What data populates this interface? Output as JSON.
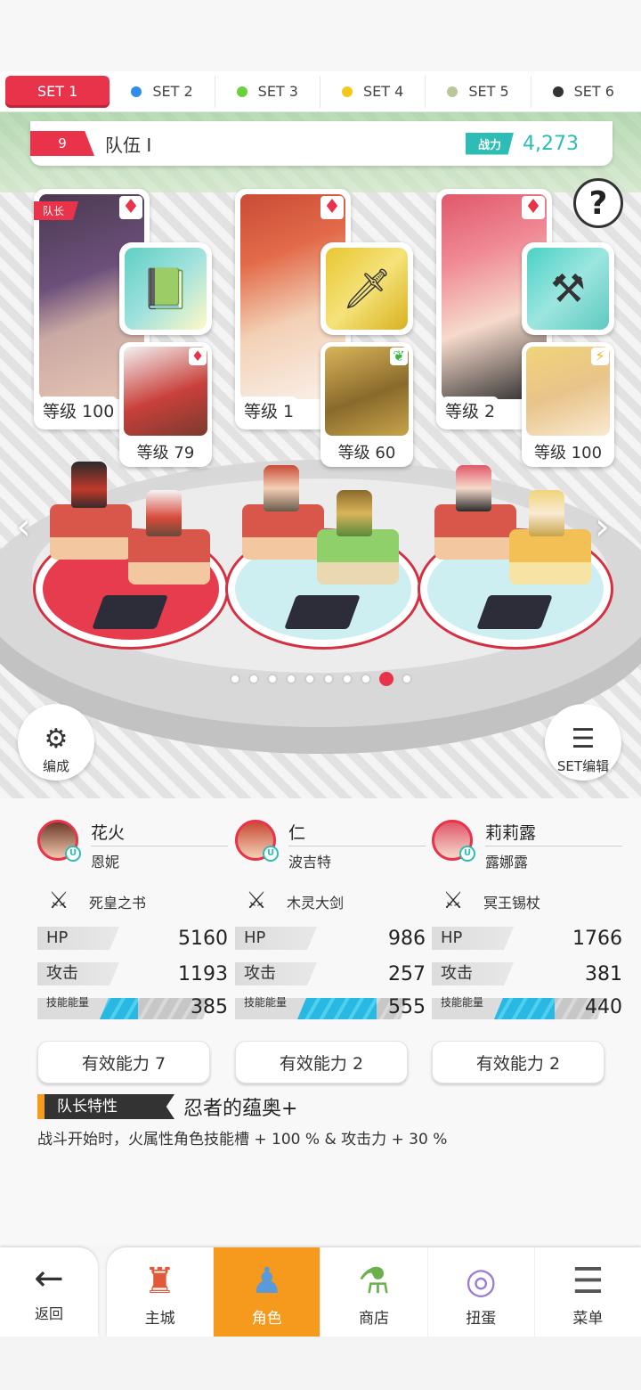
{
  "set_tabs": [
    {
      "label": "SET 1",
      "color": "",
      "active": true
    },
    {
      "label": "SET 2",
      "color": "#2e8ef0"
    },
    {
      "label": "SET 3",
      "color": "#6ad13a"
    },
    {
      "label": "SET 4",
      "color": "#f2c81c"
    },
    {
      "label": "SET 5",
      "color": "#b9c79a"
    },
    {
      "label": "SET 6",
      "color": "#333333"
    }
  ],
  "team": {
    "number": "9",
    "name": "队伍 I",
    "power_label": "战力",
    "power_value": "4,273"
  },
  "help": "?",
  "cards": [
    {
      "leader_tag": "队长",
      "level": "等级 100",
      "suit": "◆◆◆",
      "sub_level": "等级 79",
      "sub_suit": "♦",
      "equip_icon": "book-icon"
    },
    {
      "level": "等级 1",
      "suit": "◆◆◆",
      "sub_level": "等级 60",
      "sub_suit": "❦",
      "equip_icon": "sword-icon"
    },
    {
      "level": "等级 2",
      "suit": "◆◆◆",
      "sub_level": "等级 100",
      "sub_suit": "⚡",
      "equip_icon": "staff-icon"
    }
  ],
  "pager": {
    "count": 10,
    "active": 8
  },
  "buttons": {
    "formation": "编成",
    "set_edit": "SET编辑"
  },
  "characters": [
    {
      "name": "花火",
      "sub": "恩妮",
      "weapon": "死皇之书",
      "hp_label": "HP",
      "hp": "5160",
      "atk_label": "攻击",
      "atk": "1193",
      "energy_label": "技能能量",
      "energy": "385",
      "energy_fill": 0.35,
      "ability": "有效能力 7"
    },
    {
      "name": "仁",
      "sub": "波吉特",
      "weapon": "木灵大剑",
      "hp_label": "HP",
      "hp": "986",
      "atk_label": "攻击",
      "atk": "257",
      "energy_label": "技能能量",
      "energy": "555",
      "energy_fill": 0.72,
      "ability": "有效能力 2"
    },
    {
      "name": "莉莉露",
      "sub": "露娜露",
      "weapon": "冥王锡杖",
      "hp_label": "HP",
      "hp": "1766",
      "atk_label": "攻击",
      "atk": "381",
      "energy_label": "技能能量",
      "energy": "440",
      "energy_fill": 0.55,
      "ability": "有效能力 2"
    }
  ],
  "leader_skill": {
    "tag": "队长特性",
    "name": "忍者的蕴奥+",
    "desc": "战斗开始时，火属性角色技能槽 + 100 % & 攻击力 + 30 %"
  },
  "nav": {
    "back": "返回",
    "items": [
      {
        "label": "主城",
        "icon": "castle-icon",
        "active": false
      },
      {
        "label": "角色",
        "icon": "character-icon",
        "active": true
      },
      {
        "label": "商店",
        "icon": "shop-icon",
        "active": false
      },
      {
        "label": "扭蛋",
        "icon": "gacha-icon",
        "active": false
      },
      {
        "label": "菜单",
        "icon": "menu-icon",
        "active": false
      }
    ]
  }
}
